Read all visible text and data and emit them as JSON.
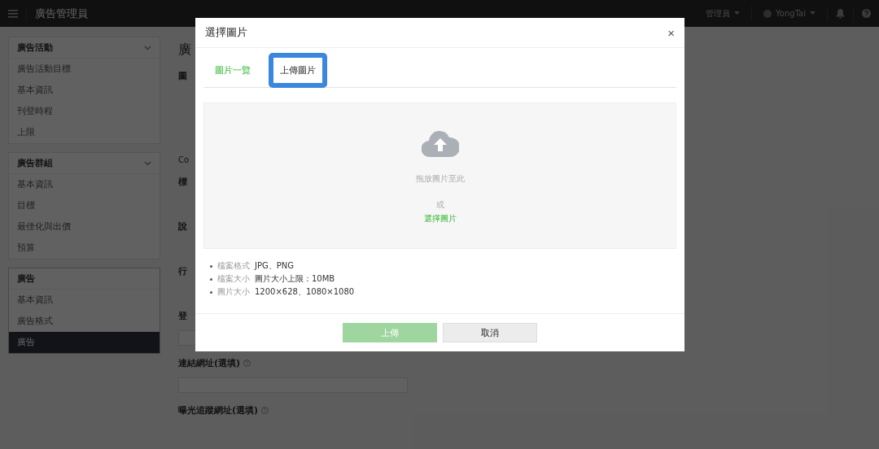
{
  "header": {
    "title": "廣告管理員",
    "role_menu": "管理員",
    "account_menu": "YongTai"
  },
  "sidebar": {
    "sections": [
      {
        "title": "廣告活動",
        "collapsible": true,
        "selected": false,
        "items": [
          {
            "label": "廣告活動目標",
            "selected": false
          },
          {
            "label": "基本資訊",
            "selected": false
          },
          {
            "label": "刊登時程",
            "selected": false
          },
          {
            "label": "上限",
            "selected": false
          }
        ]
      },
      {
        "title": "廣告群組",
        "collapsible": true,
        "selected": false,
        "items": [
          {
            "label": "基本資訊",
            "selected": false
          },
          {
            "label": "目標",
            "selected": false
          },
          {
            "label": "最佳化與出價",
            "selected": false
          },
          {
            "label": "預算",
            "selected": false
          }
        ]
      },
      {
        "title": "廣告",
        "collapsible": false,
        "selected": true,
        "items": [
          {
            "label": "基本資訊",
            "selected": false
          },
          {
            "label": "廣告格式",
            "selected": false
          },
          {
            "label": "廣告",
            "selected": true
          }
        ]
      }
    ]
  },
  "form": {
    "rows": [
      {
        "kind": "title",
        "text": "廣"
      },
      {
        "kind": "label",
        "text": "圖"
      },
      {
        "kind": "note",
        "text": "Co"
      },
      {
        "kind": "label",
        "text": "標"
      },
      {
        "kind": "label",
        "text": "說"
      },
      {
        "kind": "label",
        "text": "行"
      },
      {
        "kind": "label",
        "text": "登"
      },
      {
        "kind": "field"
      },
      {
        "kind": "label",
        "text": "連結網址(選填)",
        "help": true
      },
      {
        "kind": "field"
      },
      {
        "kind": "label",
        "text": "曝光追蹤網址(選填)",
        "help": true
      }
    ]
  },
  "dialog": {
    "title": "選擇圖片",
    "close": "×",
    "tabs": [
      {
        "label": "圖片一覽",
        "selected": false
      },
      {
        "label": "上傳圖片",
        "selected": true
      }
    ],
    "dropzone": {
      "hint": "拖放圖片至此",
      "or": "或",
      "link": "選擇圖片"
    },
    "requirements": [
      {
        "label": "檔案格式",
        "value": "JPG、PNG"
      },
      {
        "label": "檔案大小",
        "value": "圖片大小上限：10MB"
      },
      {
        "label": "圖片大小",
        "value": "1200×628、1080×1080"
      }
    ],
    "buttons": [
      {
        "label": "上傳",
        "kind": "primary",
        "disabled": true
      },
      {
        "label": "取消",
        "kind": "secondary",
        "disabled": false
      }
    ]
  }
}
